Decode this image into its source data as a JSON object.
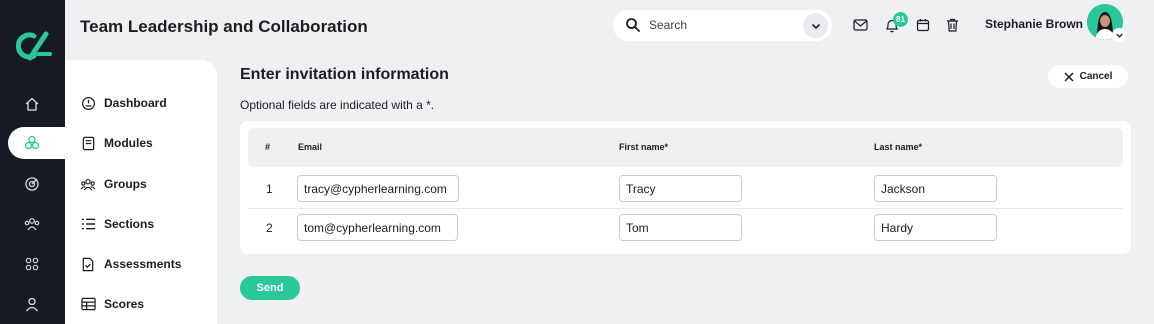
{
  "app": {
    "brand_color": "#2ac79a",
    "rail_color": "#161a26"
  },
  "header": {
    "title": "Team Leadership and Collaboration",
    "search": {
      "placeholder": "Search"
    },
    "notifications_count": "81",
    "user_name": "Stephanie Brown"
  },
  "rail": {
    "items": [
      {
        "icon": "home-icon"
      },
      {
        "icon": "learning-icon",
        "active": true
      },
      {
        "icon": "target-icon"
      },
      {
        "icon": "people-icon"
      },
      {
        "icon": "apps-grid-icon"
      },
      {
        "icon": "profile-icon"
      }
    ]
  },
  "subnav": {
    "items": [
      {
        "label": "Dashboard",
        "icon": "dashboard-icon"
      },
      {
        "label": "Modules",
        "icon": "book-icon"
      },
      {
        "label": "Groups",
        "icon": "groups-icon"
      },
      {
        "label": "Sections",
        "icon": "list-icon"
      },
      {
        "label": "Assessments",
        "icon": "assessment-icon"
      },
      {
        "label": "Scores",
        "icon": "table-icon"
      }
    ]
  },
  "main": {
    "title": "Enter invitation information",
    "note": "Optional fields are indicated with a *.",
    "cancel_label": "Cancel",
    "send_label": "Send",
    "table": {
      "columns": [
        "#",
        "Email",
        "First name*",
        "Last name*"
      ],
      "rows": [
        {
          "num": "1",
          "email": "tracy@cypherlearning.com",
          "first": "Tracy",
          "last": "Jackson"
        },
        {
          "num": "2",
          "email": "tom@cypherlearning.com",
          "first": "Tom",
          "last": "Hardy"
        }
      ]
    }
  }
}
